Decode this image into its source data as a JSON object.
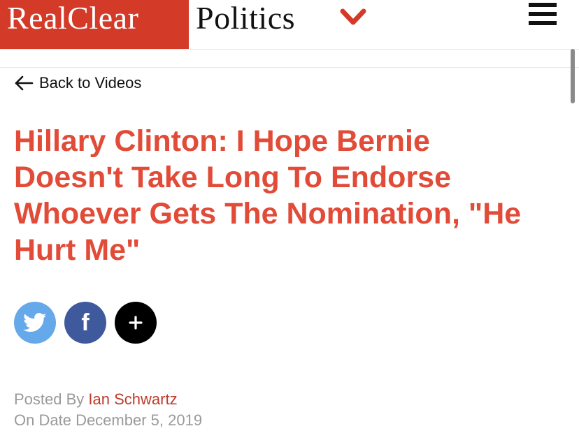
{
  "header": {
    "brand_red": "RealClear",
    "brand_black": "Politics",
    "brand_red_color": "#d33a28",
    "chevron_icon": "chevron-down-icon",
    "menu_icon": "hamburger-menu-icon"
  },
  "nav": {
    "back_label": "Back to Videos"
  },
  "article": {
    "title": "Hillary Clinton: I Hope Bernie Doesn't Take Long To Endorse Whoever Gets The Nomination, \"He Hurt Me\"",
    "title_color": "#e14b37",
    "posted_by_label": "Posted By",
    "author": "Ian Schwartz",
    "date_label": "On Date",
    "date": "December 5, 2019"
  },
  "share": {
    "twitter_icon": "twitter-icon",
    "facebook_icon": "facebook-icon",
    "more_icon": "plus-icon",
    "facebook_glyph": "f",
    "more_glyph": "+"
  }
}
